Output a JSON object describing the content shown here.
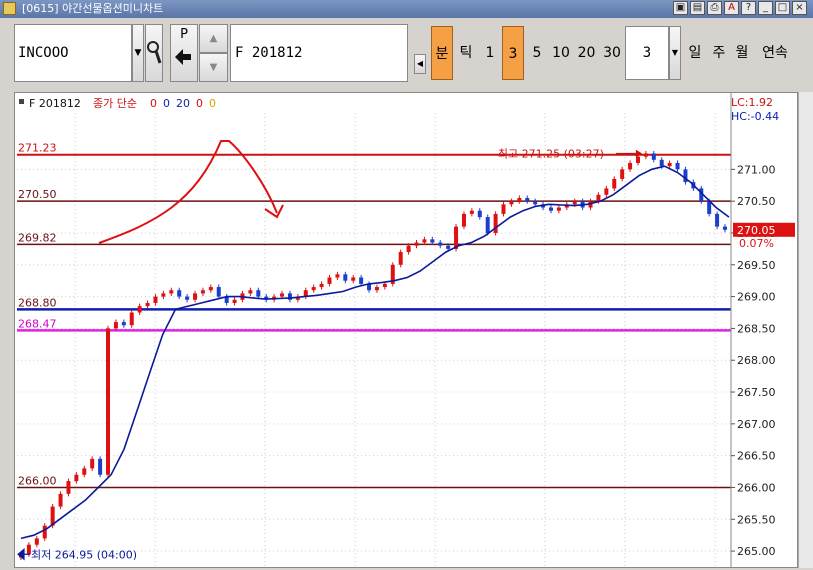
{
  "window": {
    "title": "[0615] 야간선물옵션미니차트",
    "buttons": [
      "▣",
      "▤",
      "⎙",
      "A",
      "?",
      "_",
      "□",
      "×"
    ]
  },
  "toolbar": {
    "symbol_code": "INCOOO",
    "p_label": "P",
    "contract": "F  201812",
    "periods": [
      {
        "label": "분",
        "active": true
      },
      {
        "label": "틱",
        "active": false
      },
      {
        "label": "1",
        "active": false
      },
      {
        "label": "3",
        "active": true
      },
      {
        "label": "5",
        "active": false
      },
      {
        "label": "10",
        "active": false
      },
      {
        "label": "20",
        "active": false
      },
      {
        "label": "30",
        "active": false
      }
    ],
    "interval_value": "3",
    "ranges": [
      "일",
      "주",
      "월",
      "연속"
    ]
  },
  "legend": {
    "symbol": "F 201812",
    "series": "종가 단순",
    "params": [
      "0",
      "0",
      "20",
      "0",
      "0"
    ]
  },
  "info": {
    "lc": "LC:1.92",
    "hc": "HC:-0.44",
    "current_price": "270.05",
    "change_pct": "0.07%"
  },
  "chart_data": {
    "type": "candlestick",
    "ylim": [
      264.75,
      272.2
    ],
    "yticks": [
      "271.00",
      "270.50",
      "270.00",
      "269.50",
      "269.00",
      "268.50",
      "268.00",
      "267.50",
      "267.00",
      "266.50",
      "266.00",
      "265.50",
      "265.00"
    ],
    "horizontal_lines": [
      {
        "value": 271.23,
        "label": "271.23",
        "color": "#cc1111"
      },
      {
        "value": 270.5,
        "label": "270.50",
        "color": "#6b1010"
      },
      {
        "value": 269.82,
        "label": "269.82",
        "color": "#6b1010"
      },
      {
        "value": 268.8,
        "label": "268.80",
        "color": "#1020b0"
      },
      {
        "value": 268.47,
        "label": "268.47",
        "color": "#e020e0"
      },
      {
        "value": 266.0,
        "label": "266.00",
        "color": "#6b1010"
      }
    ],
    "annotations": {
      "high": "최고 271.25 (03:27)",
      "low": "최저 264.95 (04:00)"
    },
    "close_path": [
      264.95,
      265.1,
      265.2,
      265.4,
      265.7,
      265.9,
      266.1,
      266.2,
      266.3,
      266.45,
      266.2,
      268.5,
      268.6,
      268.55,
      268.75,
      268.85,
      268.9,
      269.0,
      269.05,
      269.1,
      269.0,
      268.95,
      269.05,
      269.1,
      269.15,
      269.0,
      268.9,
      268.95,
      269.05,
      269.1,
      269.0,
      268.95,
      269.0,
      269.05,
      268.95,
      269.0,
      269.1,
      269.15,
      269.2,
      269.3,
      269.35,
      269.25,
      269.3,
      269.2,
      269.1,
      269.15,
      269.2,
      269.5,
      269.7,
      269.8,
      269.85,
      269.9,
      269.85,
      269.8,
      269.75,
      270.1,
      270.3,
      270.35,
      270.25,
      270.0,
      270.3,
      270.45,
      270.5,
      270.55,
      270.5,
      270.45,
      270.4,
      270.35,
      270.4,
      270.45,
      270.5,
      270.4,
      270.5,
      270.6,
      270.7,
      270.85,
      271.0,
      271.1,
      271.2,
      271.25,
      271.15,
      271.05,
      271.1,
      271.0,
      270.8,
      270.7,
      270.5,
      270.3,
      270.1,
      270.05
    ],
    "ma20_path": [
      265.2,
      265.25,
      265.35,
      265.5,
      265.65,
      265.8,
      266.0,
      266.2,
      266.6,
      267.2,
      267.8,
      268.4,
      268.8,
      268.85,
      268.9,
      268.95,
      269.0,
      269.0,
      268.98,
      268.96,
      268.97,
      268.98,
      269.0,
      269.02,
      269.05,
      269.08,
      269.15,
      269.2,
      269.22,
      269.25,
      269.3,
      269.4,
      269.55,
      269.7,
      269.8,
      269.85,
      269.95,
      270.1,
      270.25,
      270.35,
      270.42,
      270.45,
      270.44,
      270.43,
      270.45,
      270.5,
      270.6,
      270.75,
      270.9,
      271.0,
      271.05,
      270.95,
      270.8,
      270.6,
      270.4,
      270.25
    ]
  }
}
